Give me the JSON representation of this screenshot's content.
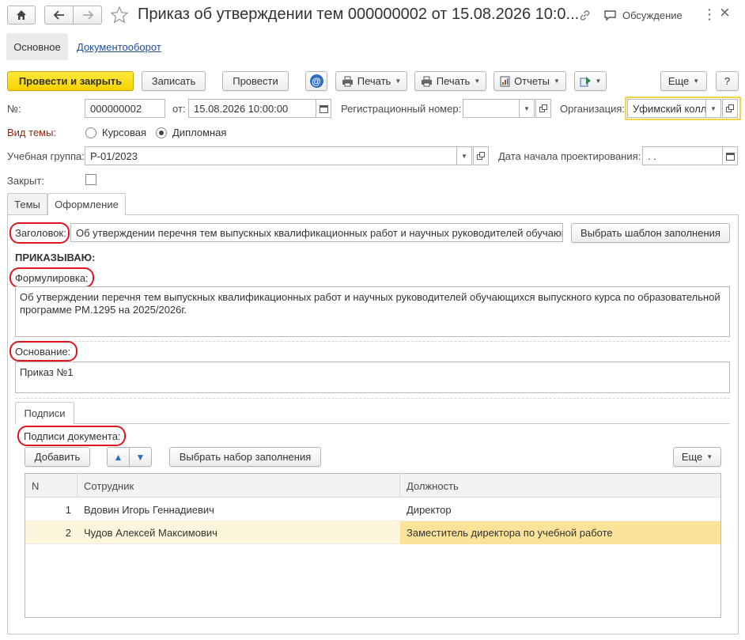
{
  "window": {
    "title": "Приказ об утверждении тем 000000002 от 15.08.2026 10:0...",
    "discussion_label": "Обсуждение",
    "more_label": "⋮",
    "close_label": "×"
  },
  "nav_tabs": {
    "main": "Основное",
    "docflow": "Документооборот"
  },
  "toolbar": {
    "post_close": "Провести и закрыть",
    "save": "Записать",
    "post": "Провести",
    "email_icon": "@",
    "print1": "Печать",
    "print2": "Печать",
    "reports": "Отчеты",
    "more": "Еще",
    "help": "?"
  },
  "header": {
    "number_label": "№:",
    "number_value": "000000002",
    "date_label": "от:",
    "date_value": "15.08.2026 10:00:00",
    "reg_label": "Регистрационный номер:",
    "reg_value": "",
    "org_label": "Организация:",
    "org_value": "Уфимский колл",
    "topic_label": "Вид темы:",
    "topic_options": [
      "Курсовая",
      "Дипломная"
    ],
    "topic_selected": "Дипломная",
    "group_label": "Учебная группа:",
    "group_value": "Р-01/2023",
    "design_start_label": "Дата начала проектирования:",
    "design_start_value": " .  .",
    "closed_label": "Закрыт:"
  },
  "tabs": {
    "themes": "Темы",
    "design": "Оформление"
  },
  "design": {
    "heading_label": "Заголовок:",
    "heading_value": "Об утверждении перечня тем выпускных квалификационных работ и научных руководителей обучающ",
    "template_button": "Выбрать шаблон заполнения",
    "order_caption": "ПРИКАЗЫВАЮ:",
    "wording_label": "Формулировка:",
    "wording_value": "Об утверждении перечня тем выпускных квалификационных работ и научных руководителей обучающихся выпускного курса по образовательной программе РМ.1295 на 2025/2026г.",
    "basis_label": "Основание:",
    "basis_value": "Приказ №1"
  },
  "signatures": {
    "tab_label": "Подписи",
    "section_label": "Подписи документа:",
    "add_button": "Добавить",
    "up_icon": "▲",
    "down_icon": "▼",
    "fill_set_button": "Выбрать набор заполнения",
    "more_button": "Еще",
    "columns": [
      "N",
      "Сотрудник",
      "Должность"
    ],
    "rows": [
      {
        "n": "1",
        "employee": "Вдовин Игорь Геннадиевич",
        "position": "Директор"
      },
      {
        "n": "2",
        "employee": "Чудов Алексей Максимович",
        "position": "Заместитель директора по учебной работе"
      }
    ]
  },
  "colors": {
    "primary_button": "#f6d100",
    "link": "#1f4fa3",
    "highlight_row": "#fdf6dc",
    "highlight_cell": "#fbe39a",
    "annotation": "#e0161e",
    "topic_label": "#8b2a14"
  }
}
